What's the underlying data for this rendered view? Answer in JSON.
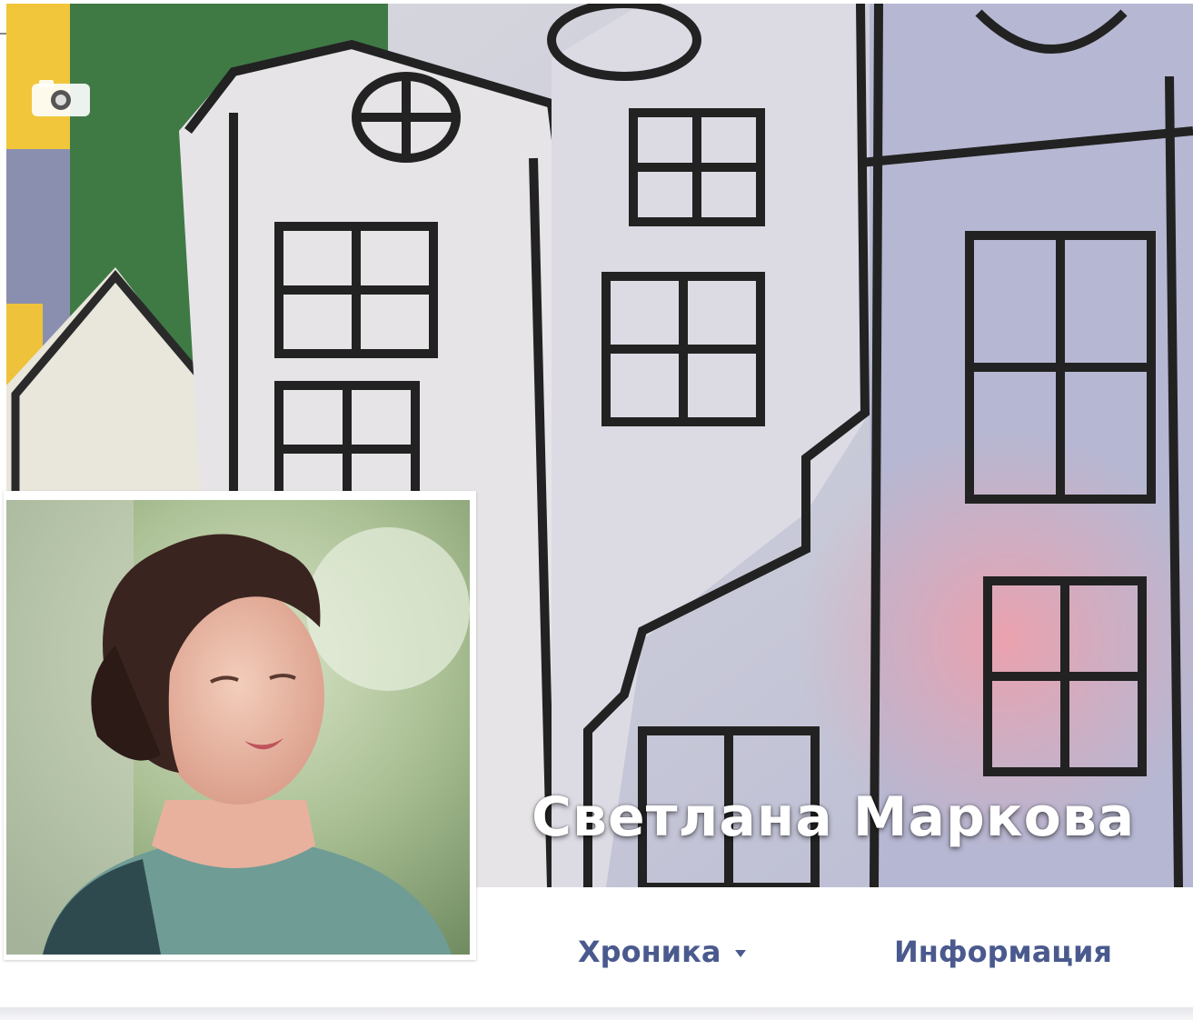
{
  "profile": {
    "name": "Светлана Маркова"
  },
  "nav": {
    "timeline_label": "Хроника",
    "info_label": "Информация"
  },
  "icons": {
    "cover_camera": "camera-icon",
    "timeline_dropdown": "caret-down-icon"
  },
  "colors": {
    "nav_link": "#4a5a8e",
    "name_text": "#ffffff",
    "cover_green": "#3f7a45",
    "cover_lilac": "#b6b7d2",
    "cover_pink": "#e3a2ad"
  }
}
